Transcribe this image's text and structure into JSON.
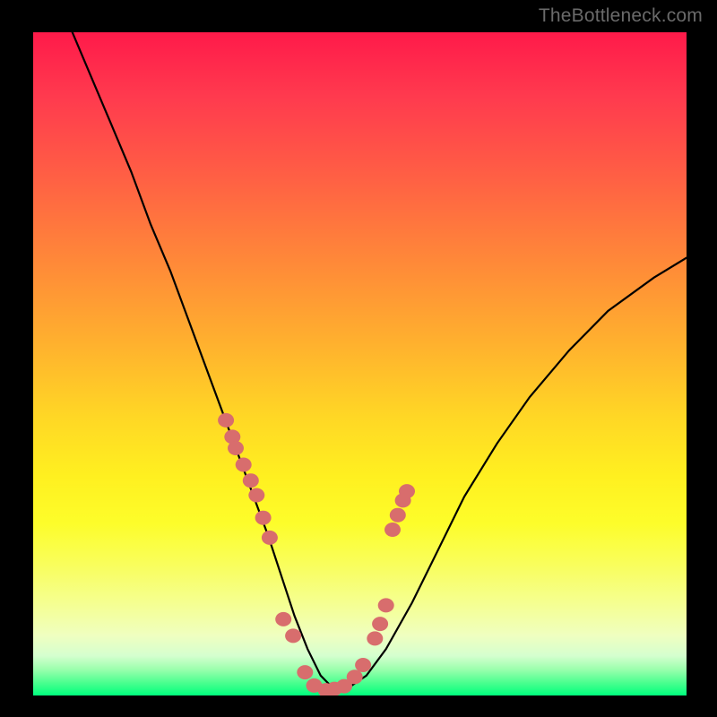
{
  "watermark": "TheBottleneck.com",
  "chart_data": {
    "type": "line",
    "title": "",
    "xlabel": "",
    "ylabel": "",
    "xlim": [
      0,
      100
    ],
    "ylim": [
      0,
      100
    ],
    "curve": {
      "name": "bottleneck-curve",
      "x": [
        6,
        9,
        12,
        15,
        18,
        21,
        24,
        27,
        30,
        33,
        36,
        38,
        40,
        42,
        44,
        46,
        48,
        51,
        54,
        58,
        62,
        66,
        71,
        76,
        82,
        88,
        95,
        100
      ],
      "y": [
        100,
        93,
        86,
        79,
        71,
        64,
        56,
        48,
        40,
        32,
        24,
        18,
        12,
        7,
        3,
        1,
        1,
        3,
        7,
        14,
        22,
        30,
        38,
        45,
        52,
        58,
        63,
        66
      ]
    },
    "points": {
      "name": "sample-points",
      "x": [
        29.5,
        30.5,
        31.0,
        32.2,
        33.3,
        34.2,
        35.2,
        36.2,
        38.3,
        39.8,
        41.6,
        43.0,
        44.8,
        46.1,
        47.6,
        49.2,
        50.5,
        52.3,
        53.1,
        54.0,
        55.0,
        55.8,
        56.6,
        57.2
      ],
      "y": [
        41.5,
        39.0,
        37.3,
        34.8,
        32.4,
        30.2,
        26.8,
        23.8,
        11.5,
        9.0,
        3.5,
        1.5,
        0.8,
        1.0,
        1.4,
        2.8,
        4.6,
        8.6,
        10.8,
        13.6,
        25.0,
        27.2,
        29.4,
        30.8
      ]
    },
    "gradient_stops": [
      {
        "offset": 0.0,
        "color": "#ff1a4a"
      },
      {
        "offset": 0.35,
        "color": "#ff8a38"
      },
      {
        "offset": 0.67,
        "color": "#fff020"
      },
      {
        "offset": 0.92,
        "color": "#efffc0"
      },
      {
        "offset": 1.0,
        "color": "#00ff7d"
      }
    ]
  }
}
